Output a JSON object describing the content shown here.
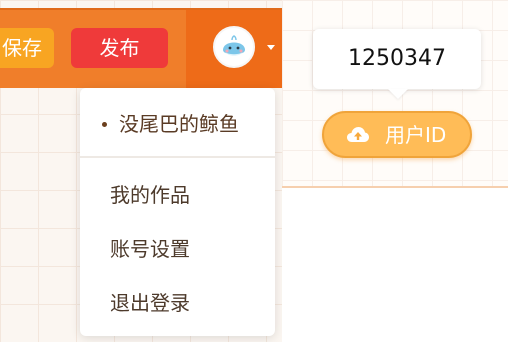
{
  "toolbar": {
    "save_label": "保存",
    "publish_label": "发布"
  },
  "user_menu": {
    "username": "没尾巴的鲸鱼",
    "items": [
      {
        "label": "我的作品"
      },
      {
        "label": "账号设置"
      },
      {
        "label": "退出登录"
      }
    ]
  },
  "user_id_panel": {
    "tooltip_value": "1250347",
    "button_label": "用户ID",
    "button_icon": "cloud-upload-icon"
  },
  "colors": {
    "topbar": "#f07e2a",
    "publish": "#ef3a3a",
    "save": "#f8a522",
    "userid_button": "#ffbc57"
  }
}
